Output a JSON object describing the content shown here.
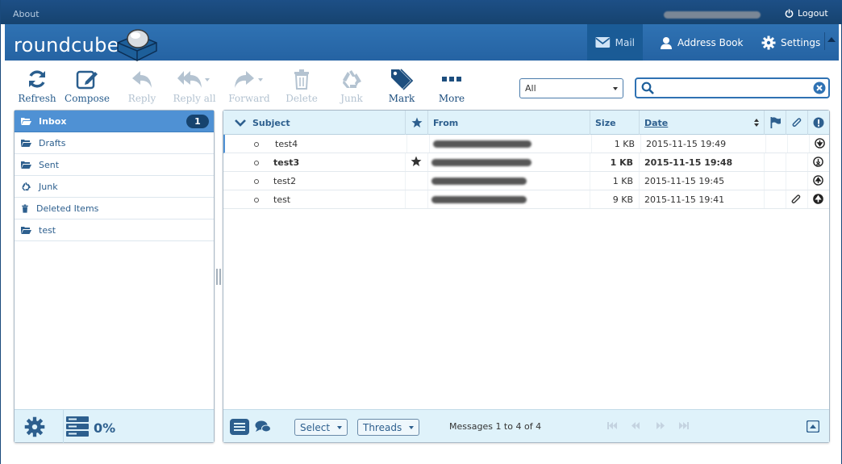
{
  "topbar": {
    "about": "About",
    "logout": "Logout"
  },
  "header": {
    "logo": "roundcube",
    "tabs": [
      {
        "label": "Mail",
        "icon": "envelope-icon",
        "active": true
      },
      {
        "label": "Address Book",
        "icon": "person-icon"
      },
      {
        "label": "Settings",
        "icon": "gear-icon"
      }
    ]
  },
  "toolbar": {
    "refresh": "Refresh",
    "compose": "Compose",
    "reply": "Reply",
    "reply_all": "Reply all",
    "forward": "Forward",
    "delete": "Delete",
    "junk": "Junk",
    "mark": "Mark",
    "more": "More"
  },
  "filter": {
    "selected": "All"
  },
  "search": {
    "value": ""
  },
  "folders": [
    {
      "name": "Inbox",
      "icon": "folder-open-icon",
      "unread": "1",
      "selected": true
    },
    {
      "name": "Drafts",
      "icon": "folder-icon"
    },
    {
      "name": "Sent",
      "icon": "folder-icon"
    },
    {
      "name": "Junk",
      "icon": "recycle-icon"
    },
    {
      "name": "Deleted Items",
      "icon": "trash-icon"
    },
    {
      "name": "test",
      "icon": "folder-icon"
    }
  ],
  "quota": {
    "text": "0%"
  },
  "list": {
    "columns": {
      "subject": "Subject",
      "from": "From",
      "size": "Size",
      "date": "Date"
    },
    "messages": [
      {
        "subject": "test4",
        "size": "1 KB",
        "date": "2015-11-15 19:49",
        "flagged": false,
        "attachment": false,
        "priority": "low-priority-icon",
        "unread": false
      },
      {
        "subject": "test3",
        "size": "1 KB",
        "date": "2015-11-15 19:48",
        "flagged": true,
        "attachment": false,
        "priority": "lowest-priority-icon",
        "unread": true
      },
      {
        "subject": "test2",
        "size": "1 KB",
        "date": "2015-11-15 19:45",
        "flagged": false,
        "attachment": false,
        "priority": "high-priority-icon",
        "unread": false
      },
      {
        "subject": "test",
        "size": "9 KB",
        "date": "2015-11-15 19:41",
        "flagged": false,
        "attachment": true,
        "priority": "highest-priority-icon",
        "unread": false
      }
    ],
    "footer": {
      "select": "Select",
      "threads": "Threads",
      "count": "Messages 1 to 4 of 4"
    }
  },
  "colors": {
    "header": "#2f72b3",
    "topbar": "#16436f",
    "accent": "#4f91d4",
    "panel_footer": "#dff2fa"
  }
}
